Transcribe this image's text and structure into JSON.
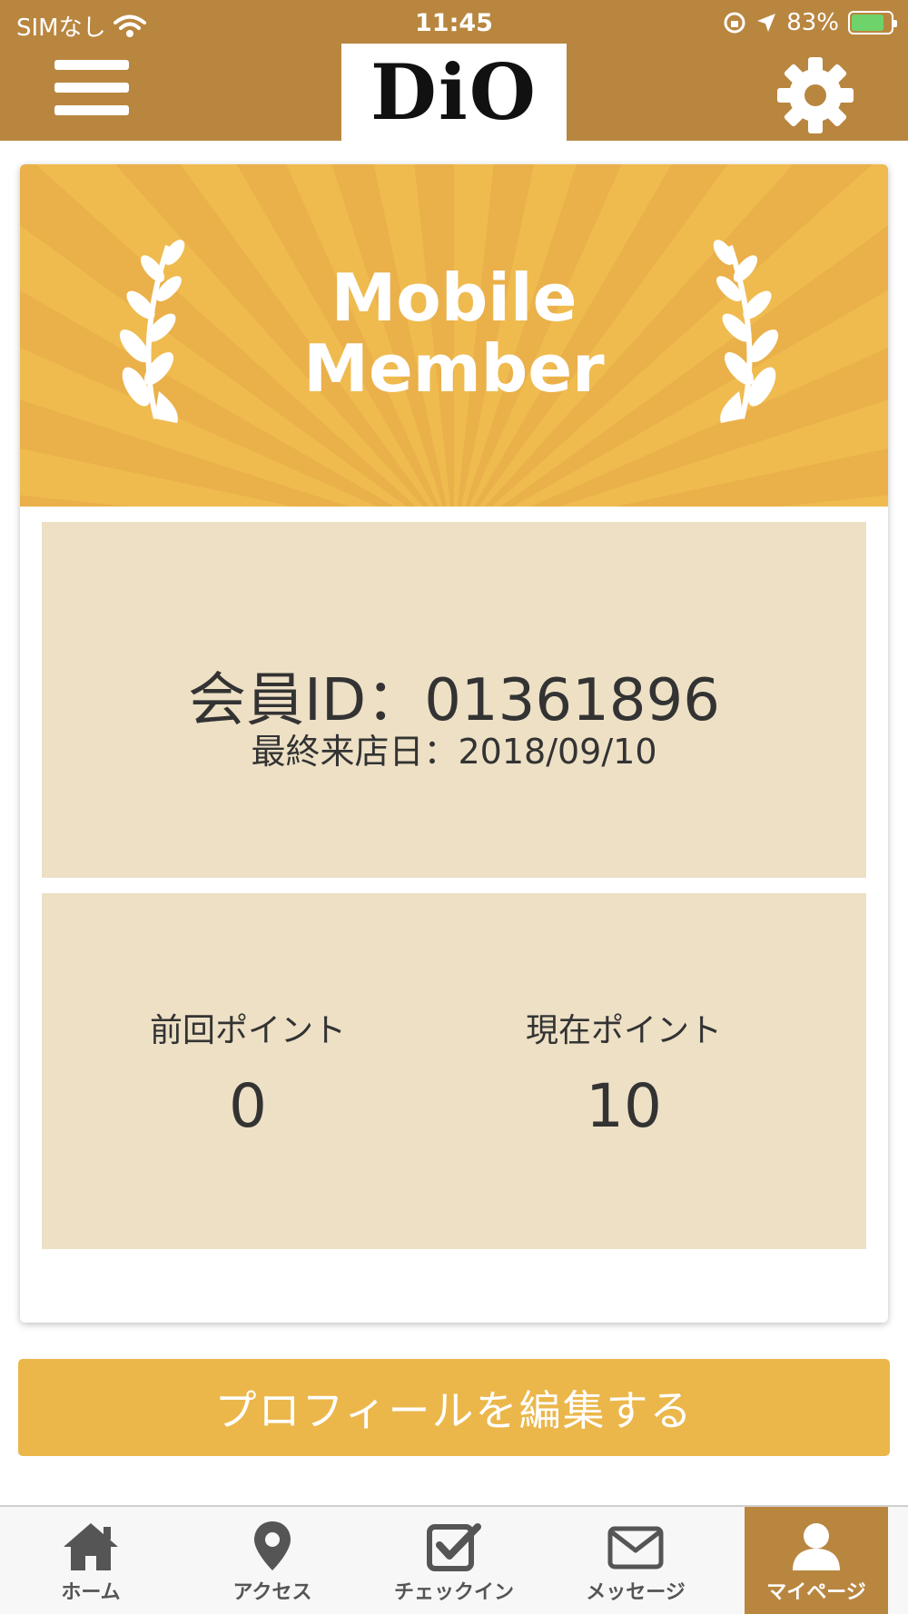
{
  "status_bar": {
    "carrier": "SIMなし",
    "time": "11:45",
    "battery_percent": "83%",
    "battery_level": 0.83
  },
  "header": {
    "logo_text": "DiO",
    "menu_icon": "hamburger-menu-icon",
    "settings_icon": "gear-icon"
  },
  "banner": {
    "line1": "Mobile",
    "line2": "Member"
  },
  "member": {
    "id_text": "会員ID：01361896",
    "last_visit_text": "最終来店日：2018/09/10"
  },
  "points": {
    "previous_label": "前回ポイント",
    "previous_value": "0",
    "current_label": "現在ポイント",
    "current_value": "10"
  },
  "edit_profile_label": "プロフィールを編集する",
  "tabs": [
    {
      "label": "ホーム",
      "icon": "home-icon",
      "active": false
    },
    {
      "label": "アクセス",
      "icon": "map-pin-icon",
      "active": false
    },
    {
      "label": "チェックイン",
      "icon": "checkbox-icon",
      "active": false
    },
    {
      "label": "メッセージ",
      "icon": "envelope-icon",
      "active": false
    },
    {
      "label": "マイページ",
      "icon": "user-icon",
      "active": true
    }
  ],
  "colors": {
    "header_bg": "#b98640",
    "banner_gold": "#efbb4f",
    "panel_beige": "#ede0c5",
    "button_gold": "#ebb74b"
  }
}
